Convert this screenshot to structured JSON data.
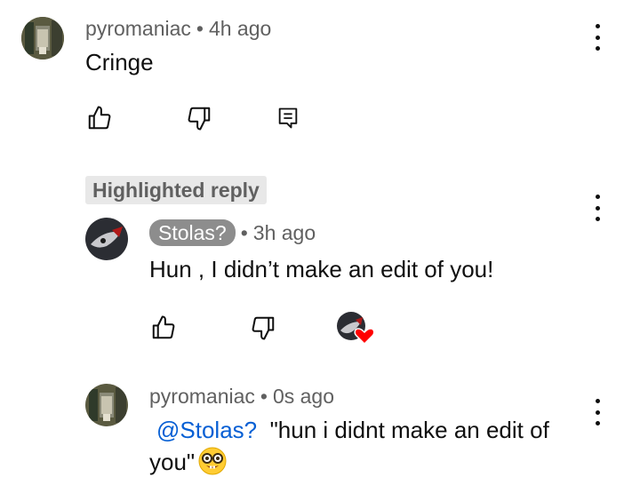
{
  "comments": [
    {
      "author": "pyromaniac",
      "time": "4h ago",
      "separator": "•",
      "text": "Cringe",
      "actions": [
        "like-icon",
        "dislike-icon",
        "reply-icon"
      ],
      "menu": "more-vert-icon"
    }
  ],
  "highlighted_label": "Highlighted reply",
  "replies": [
    {
      "author": "Stolas?",
      "author_style": "creator-chip",
      "time": "3h ago",
      "separator": "•",
      "text": "Hun , I didn’t make an edit of you!",
      "actions": [
        "like-icon",
        "dislike-icon",
        "creator-heart-icon"
      ],
      "menu": "more-vert-icon"
    },
    {
      "author": "pyromaniac",
      "time": "0s ago",
      "separator": "•",
      "mention": "@Stolas?",
      "text": "\"hun i didnt make an edit of you\"",
      "emoji": "nerd-face-emoji",
      "menu": "more-vert-icon"
    }
  ],
  "colors": {
    "mention": "#065fd4",
    "creator_chip": "#8d8d8d",
    "heart": "#ff0000",
    "meta": "#606060"
  }
}
